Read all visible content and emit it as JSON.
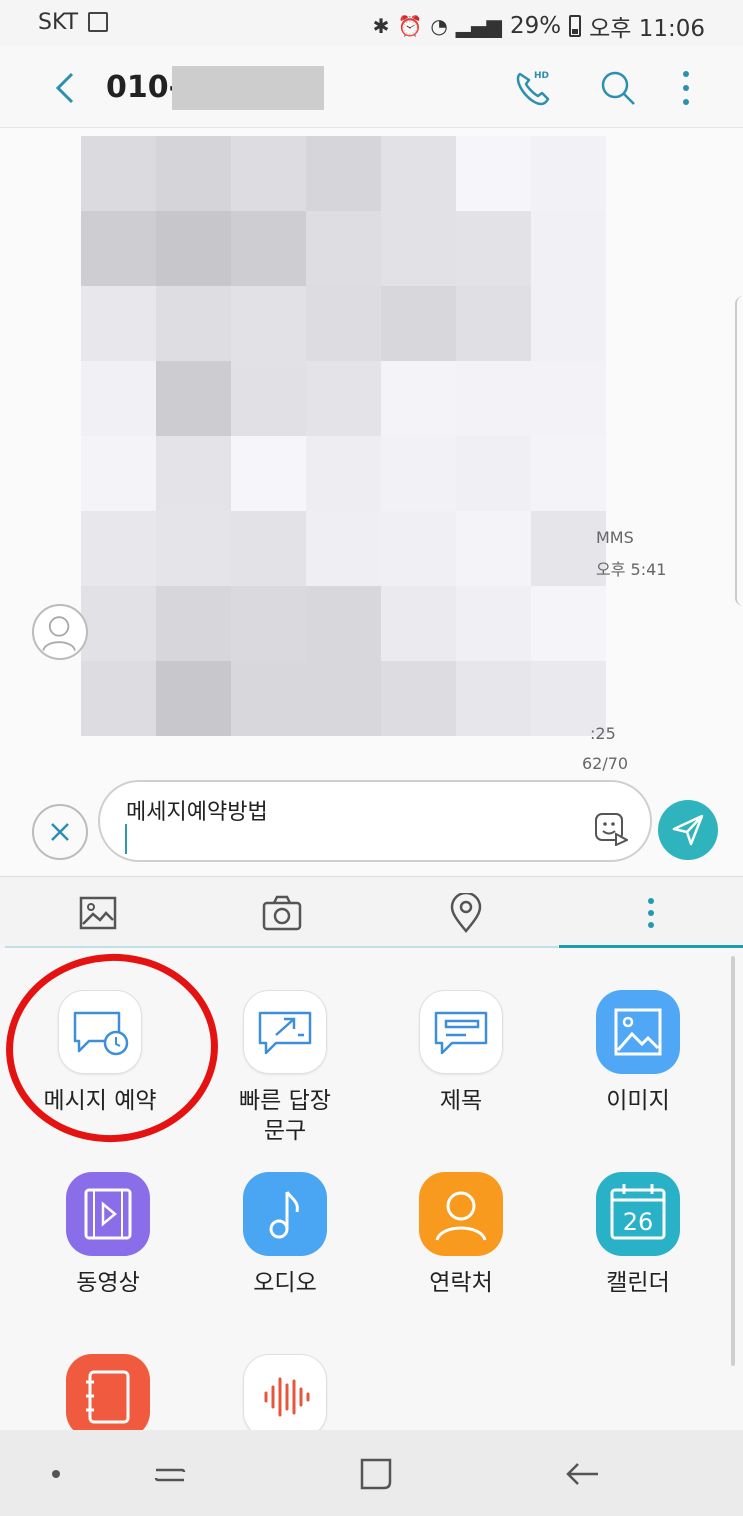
{
  "status_bar": {
    "carrier": "SKT",
    "battery": "29%",
    "time": "오후 11:06"
  },
  "app_bar": {
    "title": "010-"
  },
  "conversation": {
    "message_type": "MMS",
    "message_time": "오후 5:41",
    "message_time_partial": ":25"
  },
  "compose": {
    "char_counter": "62/70",
    "text": "메세지예약방법"
  },
  "attach_tabs": [
    "image-icon",
    "camera-icon",
    "location-icon",
    "more-icon"
  ],
  "options": [
    {
      "label": "메시지 예약",
      "icon": "schedule-message-icon"
    },
    {
      "label": "빠른 답장\n문구",
      "icon": "quick-reply-icon"
    },
    {
      "label": "제목",
      "icon": "subject-icon"
    },
    {
      "label": "이미지",
      "icon": "image-icon",
      "color": "#4fa7f5"
    },
    {
      "label": "동영상",
      "icon": "video-icon",
      "color": "#8a6de9"
    },
    {
      "label": "오디오",
      "icon": "audio-icon",
      "color": "#4aa6f2"
    },
    {
      "label": "연락처",
      "icon": "contact-icon",
      "color": "#f79a1e"
    },
    {
      "label": "캘린더",
      "icon": "calendar-icon",
      "color": "#29b2c7",
      "badge": "26"
    },
    {
      "label": "",
      "icon": "memo-icon",
      "color": "#f05a3e"
    },
    {
      "label": "",
      "icon": "voice-recording-icon"
    }
  ],
  "colors": {
    "accent": "#2fb3bd",
    "highlight": "#e51212"
  }
}
